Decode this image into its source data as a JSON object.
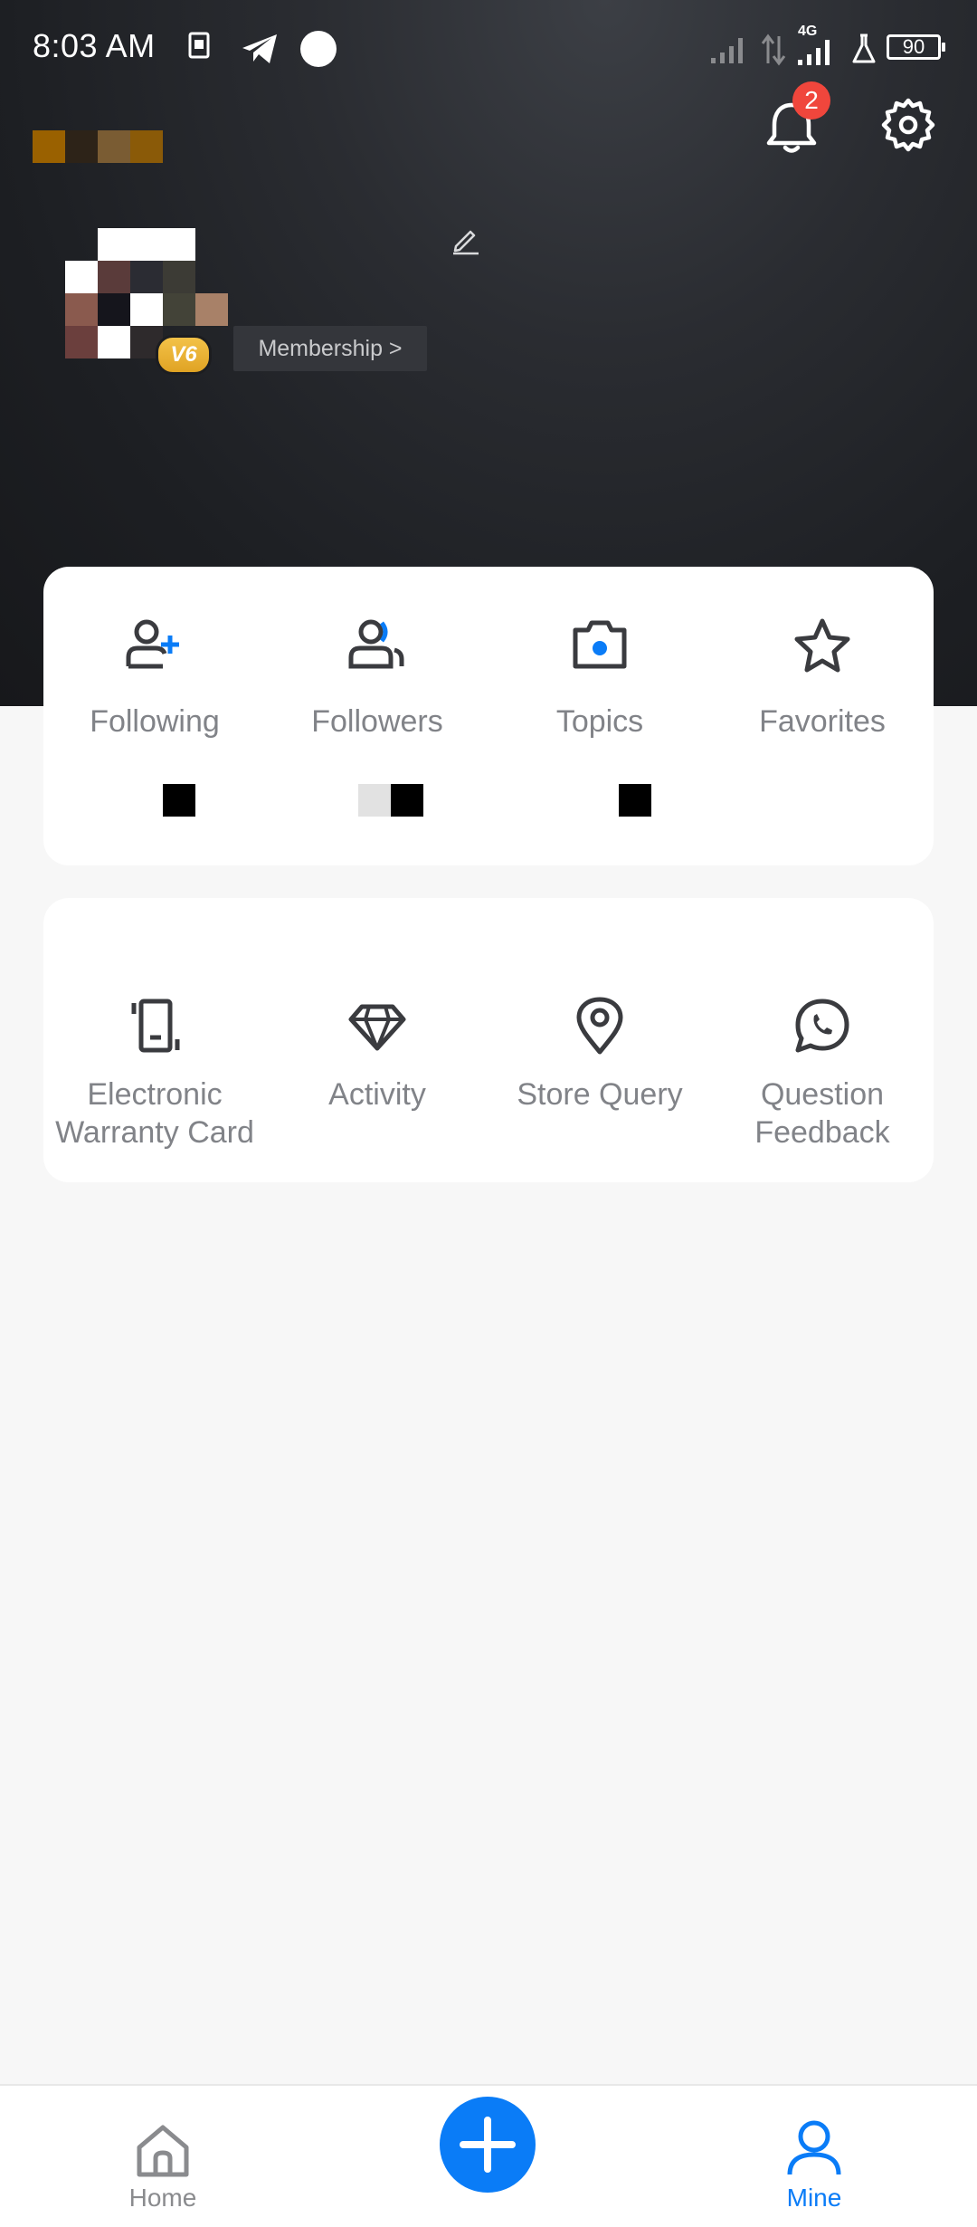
{
  "status_bar": {
    "time": "8:03 AM",
    "network": "4G",
    "battery": "90"
  },
  "header": {
    "notification_count": "2",
    "membership_label": "Membership >",
    "level_badge": "V6"
  },
  "stats": [
    {
      "label": "Following",
      "icon": "add-user-icon"
    },
    {
      "label": "Followers",
      "icon": "users-icon"
    },
    {
      "label": "Topics",
      "icon": "camera-icon"
    },
    {
      "label": "Favorites",
      "icon": "star-icon"
    }
  ],
  "services": [
    {
      "label_line1": "Electronic",
      "label_line2": "Warranty Card",
      "icon": "warranty-card-icon"
    },
    {
      "label_line1": "Activity",
      "label_line2": "",
      "icon": "diamond-icon"
    },
    {
      "label_line1": "Store Query",
      "label_line2": "",
      "icon": "location-pin-icon"
    },
    {
      "label_line1": "Question",
      "label_line2": "Feedback",
      "icon": "chat-phone-icon"
    }
  ],
  "bottom_nav": {
    "home_label": "Home",
    "mine_label": "Mine"
  },
  "colors": {
    "accent": "#0a7cf7",
    "badge": "#f0463c",
    "label_gray": "#818388",
    "icon_dark": "#3a3b3f"
  }
}
